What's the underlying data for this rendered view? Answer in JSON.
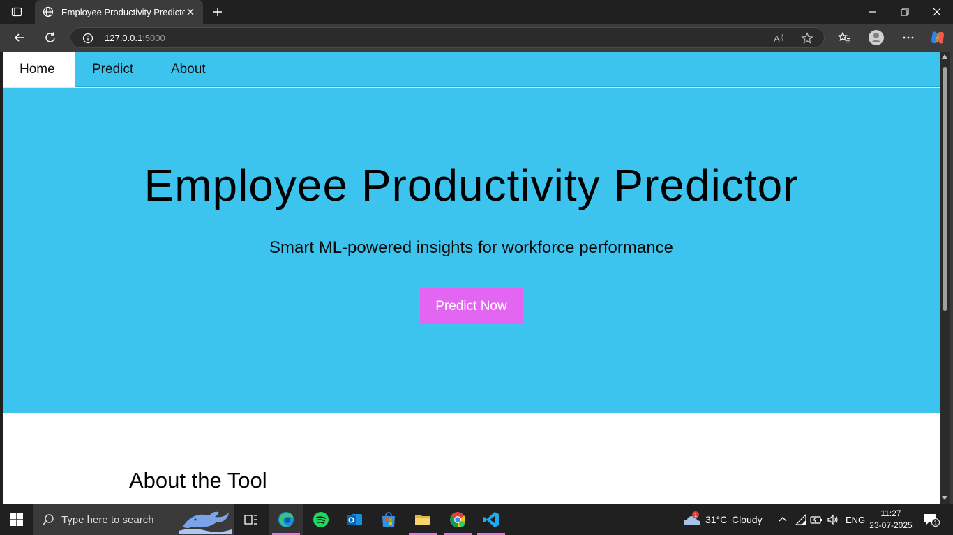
{
  "browser": {
    "tab_title": "Employee Productivity Predictor",
    "url_host": "127.0.0.1",
    "url_port": ":5000"
  },
  "nav": {
    "items": [
      {
        "label": "Home",
        "active": true
      },
      {
        "label": "Predict",
        "active": false
      },
      {
        "label": "About",
        "active": false
      }
    ]
  },
  "hero": {
    "title": "Employee Productivity Predictor",
    "subtitle": "Smart ML-powered insights for workforce performance",
    "cta_label": "Predict Now"
  },
  "about": {
    "heading": "About the Tool"
  },
  "taskbar": {
    "search_placeholder": "Type here to search",
    "weather_temp": "31°C",
    "weather_text": "Cloudy",
    "weather_badge": "1",
    "language": "ENG",
    "time": "11:27",
    "date": "23-07-2025",
    "notification_count": "1"
  },
  "colors": {
    "hero_bg": "#3cc4ef",
    "cta_bg": "#e266f1",
    "nav_active_bg": "#ffffff"
  }
}
